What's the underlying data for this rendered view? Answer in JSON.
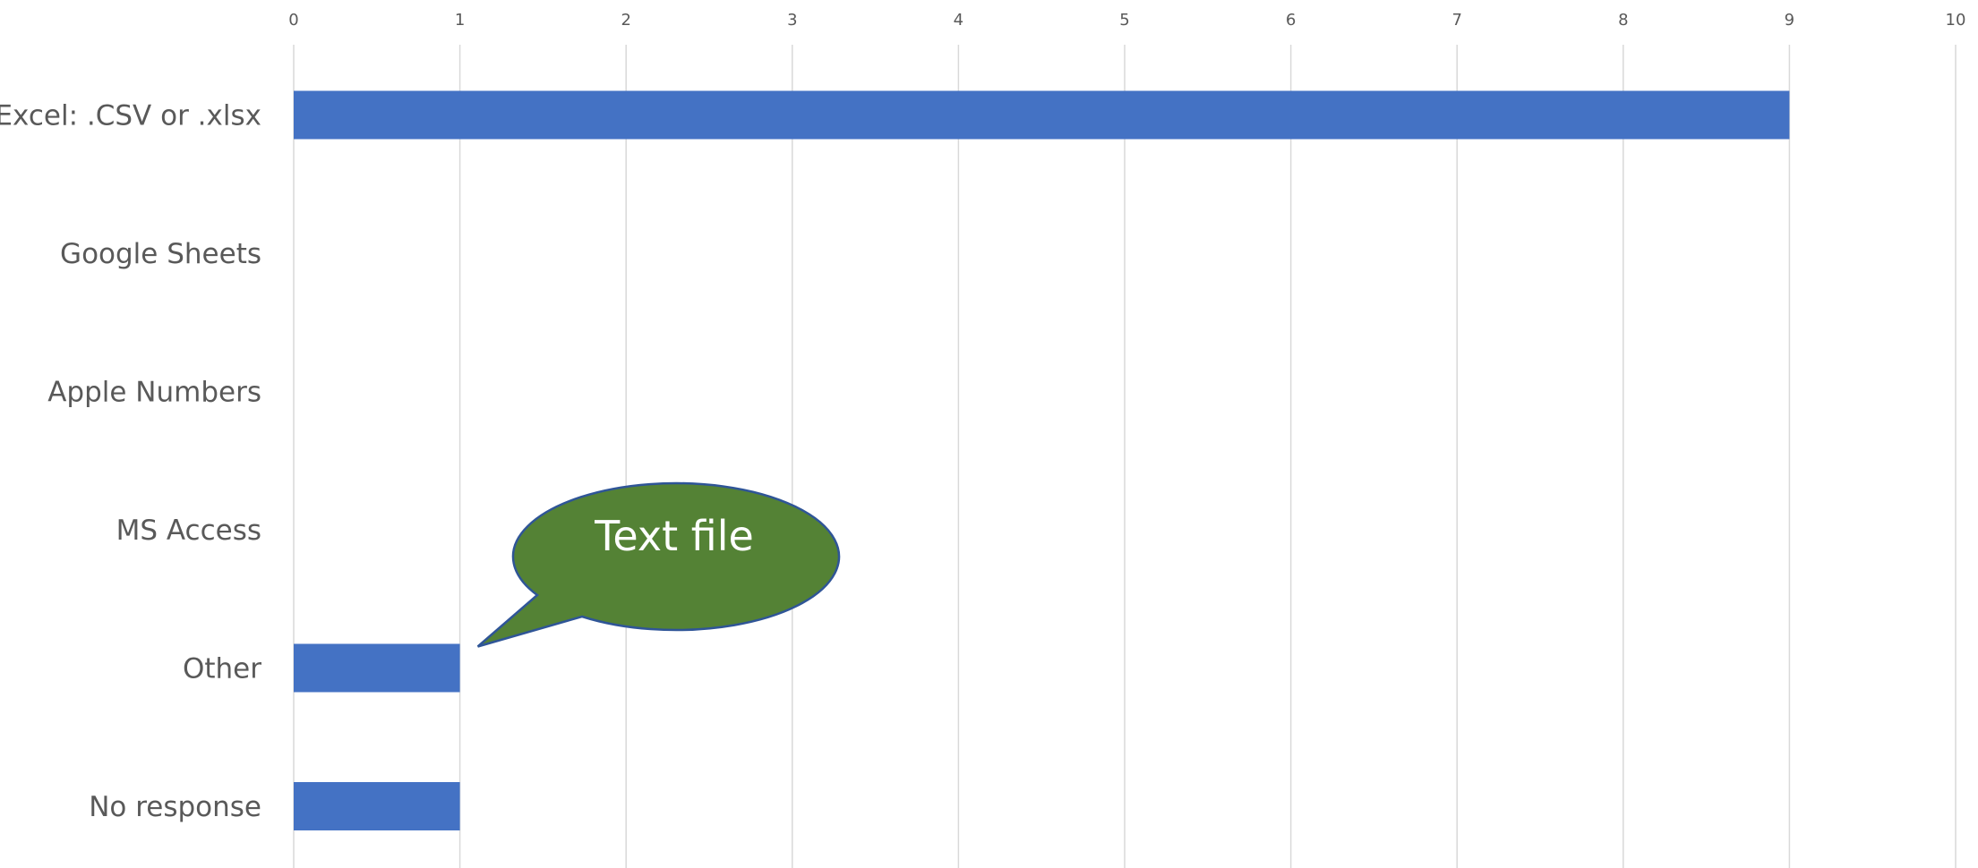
{
  "chart_data": {
    "type": "bar",
    "orientation": "horizontal",
    "categories": [
      "Excel: .CSV or .xlsx",
      "Google Sheets",
      "Apple Numbers",
      "MS Access",
      "Other",
      "No response"
    ],
    "values": [
      9,
      0,
      0,
      0,
      1,
      1
    ],
    "xlim": [
      0,
      10
    ],
    "x_ticks": [
      0,
      1,
      2,
      3,
      4,
      5,
      6,
      7,
      8,
      9,
      10
    ],
    "x_tick_labels": [
      "0",
      "1",
      "2",
      "3",
      "4",
      "5",
      "6",
      "7",
      "8",
      "9",
      "10"
    ],
    "x_axis_position": "top",
    "grid": true,
    "legend": "none",
    "title": "",
    "xlabel": "",
    "ylabel": "",
    "bar_color": "#4472C4",
    "gridline_color": "#D9D9D9",
    "label_color": "#595959",
    "annotations": [
      {
        "type": "callout",
        "text": "Text file",
        "points_to_category": "Other",
        "fill_color": "#548235",
        "border_color": "#2F5597",
        "text_color": "#FFFFFF"
      }
    ]
  }
}
